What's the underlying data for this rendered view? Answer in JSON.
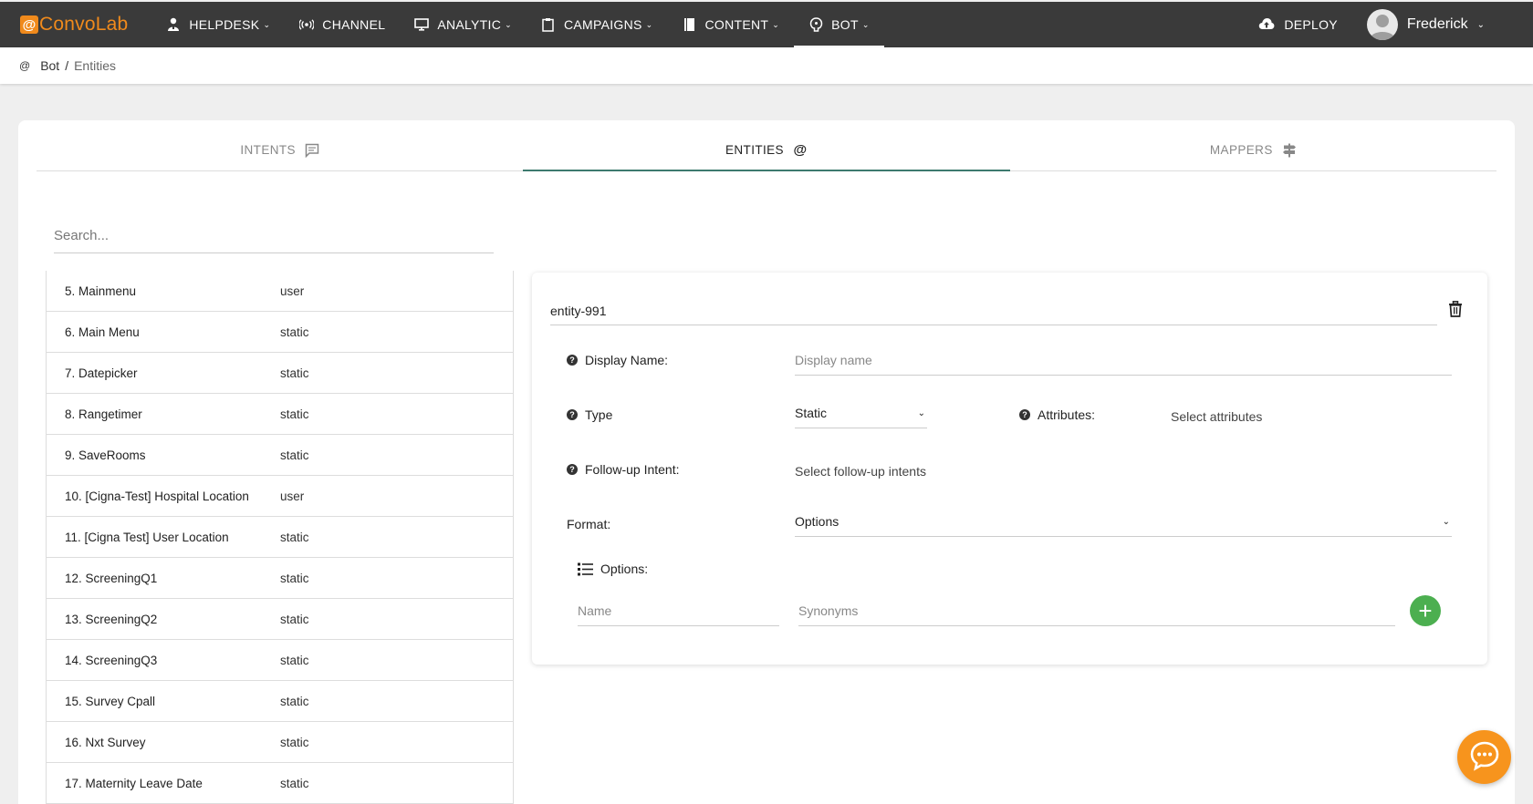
{
  "app": {
    "logo_text": "ConvoLab",
    "brand_color": "#f08a1c"
  },
  "nav": {
    "items": [
      {
        "label": "HELPDESK",
        "icon": "person-icon",
        "dropdown": true
      },
      {
        "label": "CHANNEL",
        "icon": "broadcast-icon",
        "dropdown": false
      },
      {
        "label": "ANALYTIC",
        "icon": "monitor-icon",
        "dropdown": true
      },
      {
        "label": "CAMPAIGNS",
        "icon": "clipboard-icon",
        "dropdown": true
      },
      {
        "label": "CONTENT",
        "icon": "book-icon",
        "dropdown": true
      },
      {
        "label": "BOT",
        "icon": "bot-head-icon",
        "dropdown": true,
        "active": true
      }
    ],
    "deploy_label": "DEPLOY",
    "user_name": "Frederick"
  },
  "breadcrumb": {
    "root": "Bot",
    "separator": "/",
    "current": "Entities"
  },
  "tabs": [
    {
      "label": "INTENTS",
      "icon": "message-icon",
      "active": false
    },
    {
      "label": "ENTITIES",
      "icon": "at-icon",
      "active": true
    },
    {
      "label": "MAPPERS",
      "icon": "signpost-icon",
      "active": false
    }
  ],
  "search": {
    "placeholder": "Search...",
    "value": ""
  },
  "entities": [
    {
      "name": "5. Mainmenu",
      "type": "user"
    },
    {
      "name": "6. Main Menu",
      "type": "static"
    },
    {
      "name": "7. Datepicker",
      "type": "static"
    },
    {
      "name": "8. Rangetimer",
      "type": "static"
    },
    {
      "name": "9. SaveRooms",
      "type": "static"
    },
    {
      "name": "10. [Cigna-Test] Hospital Location",
      "type": "user"
    },
    {
      "name": "11. [Cigna Test] User Location",
      "type": "static"
    },
    {
      "name": "12. ScreeningQ1",
      "type": "static"
    },
    {
      "name": "13. ScreeningQ2",
      "type": "static"
    },
    {
      "name": "14. ScreeningQ3",
      "type": "static"
    },
    {
      "name": "15. Survey Cpall",
      "type": "static"
    },
    {
      "name": "16. Nxt Survey",
      "type": "static"
    },
    {
      "name": "17. Maternity Leave Date",
      "type": "static"
    }
  ],
  "detail": {
    "entity_name": "entity-991",
    "display_name_label": "Display Name:",
    "display_name_placeholder": "Display name",
    "type_label": "Type",
    "type_value": "Static",
    "attributes_label": "Attributes:",
    "attributes_placeholder": "Select attributes",
    "followup_label": "Follow-up Intent:",
    "followup_placeholder": "Select follow-up intents",
    "format_label": "Format:",
    "format_value": "Options",
    "options_label": "Options:",
    "option_name_placeholder": "Name",
    "option_synonyms_placeholder": "Synonyms"
  },
  "colors": {
    "nav_bg": "#3a3a3a",
    "tab_underline": "#3d7a6e",
    "add_button": "#4caf50",
    "chat_bubble": "#f7941d"
  }
}
